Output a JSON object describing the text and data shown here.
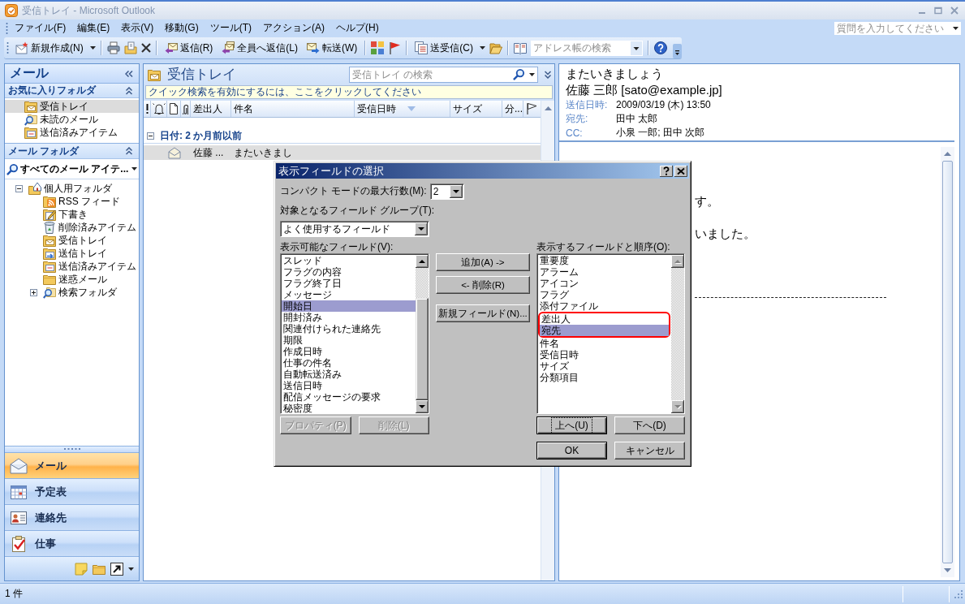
{
  "window": {
    "title": "受信トレイ - Microsoft Outlook"
  },
  "menu_bar": {
    "items": [
      "ファイル(F)",
      "編集(E)",
      "表示(V)",
      "移動(G)",
      "ツール(T)",
      "アクション(A)",
      "ヘルプ(H)"
    ],
    "help_search": {
      "placeholder": "質問を入力してください"
    }
  },
  "toolbar": {
    "new_button": "新規作成(N)",
    "respond_buttons": [
      "返信(R)",
      "全員へ返信(L)",
      "転送(W)"
    ],
    "send_receive_button": "送受信(C)",
    "address_search": {
      "placeholder": "アドレス帳の検索"
    }
  },
  "nav_pane": {
    "title": "メール",
    "favorites": {
      "title": "お気に入りフォルダ",
      "items": [
        {
          "label": "受信トレイ",
          "selected": true
        },
        {
          "label": "未読のメール",
          "selected": false
        },
        {
          "label": "送信済みアイテム",
          "selected": false
        }
      ]
    },
    "mail_folders": {
      "title": "メール フォルダ",
      "view": "すべてのメール アイテ...",
      "tree": [
        {
          "label": "個人用フォルダ",
          "expanded": true,
          "selected": false,
          "children": [
            {
              "label": "RSS フィード",
              "selected": false
            },
            {
              "label": "下書き",
              "selected": false
            },
            {
              "label": "削除済みアイテム",
              "selected": false
            },
            {
              "label": "受信トレイ",
              "selected": false
            },
            {
              "label": "送信トレイ",
              "selected": false
            },
            {
              "label": "送信済みアイテム",
              "selected": false
            },
            {
              "label": "迷惑メール",
              "selected": false
            },
            {
              "label": "検索フォルダ",
              "expanded": false,
              "selected": false
            }
          ]
        }
      ]
    },
    "buttons": [
      {
        "label": "メール",
        "selected": true
      },
      {
        "label": "予定表",
        "selected": false
      },
      {
        "label": "連絡先",
        "selected": false
      },
      {
        "label": "仕事",
        "selected": false
      }
    ]
  },
  "mail_list": {
    "title": "受信トレイ",
    "search": {
      "placeholder": "受信トレイ の検索"
    },
    "info_bar": "クイック検索を有効にするには、ここをクリックしてください",
    "columns": [
      {
        "label": "差出人",
        "sorted": false
      },
      {
        "label": "件名",
        "sorted": false
      },
      {
        "label": "受信日時",
        "sorted": true
      },
      {
        "label": "サイズ",
        "sorted": false
      },
      {
        "label": "分...",
        "sorted": false
      }
    ],
    "groups": [
      {
        "label": "日付: 2 か月前以前",
        "expanded": true,
        "rows": [
          {
            "sender": "佐藤 ...",
            "subject": "またいきまし",
            "selected": true,
            "read": true
          }
        ]
      }
    ]
  },
  "reading_pane": {
    "subject": "またいきましょう",
    "sender": "佐藤 三郎 [sato@example.jp]",
    "fields": [
      {
        "label": "送信日時:",
        "value": "2009/03/19 (木) 13:50"
      },
      {
        "label": "宛先:",
        "value": "田中 太郎"
      },
      {
        "label": "CC:",
        "value": "小泉 一郎; 田中 次郎"
      }
    ],
    "body_lines": [
      "す。",
      "いました。"
    ]
  },
  "dialog": {
    "title": "表示フィールドの選択",
    "max_rows": {
      "label": "コンパクト モードの最大行数(M):",
      "value": "2"
    },
    "field_group": {
      "label": "対象となるフィールド グループ(T):",
      "value": "よく使用するフィールド"
    },
    "available": {
      "label": "表示可能なフィールド(V):",
      "items": [
        {
          "label": "スレッド",
          "selected": false
        },
        {
          "label": "フラグの内容",
          "selected": false
        },
        {
          "label": "フラグ終了日",
          "selected": false
        },
        {
          "label": "メッセージ",
          "selected": false
        },
        {
          "label": "開始日",
          "selected": true
        },
        {
          "label": "開封済み",
          "selected": false
        },
        {
          "label": "関連付けられた連絡先",
          "selected": false
        },
        {
          "label": "期限",
          "selected": false
        },
        {
          "label": "作成日時",
          "selected": false
        },
        {
          "label": "仕事の件名",
          "selected": false
        },
        {
          "label": "自動転送済み",
          "selected": false
        },
        {
          "label": "送信日時",
          "selected": false
        },
        {
          "label": "配信メッセージの要求",
          "selected": false
        },
        {
          "label": "秘密度",
          "selected": false
        }
      ]
    },
    "move_buttons": [
      "追加(A) ->",
      "<- 削除(R)",
      "新規フィールド(N)..."
    ],
    "shown": {
      "label": "表示するフィールドと順序(O):",
      "items": [
        {
          "label": "重要度",
          "selected": false,
          "marked": false
        },
        {
          "label": "アラーム",
          "selected": false,
          "marked": false
        },
        {
          "label": "アイコン",
          "selected": false,
          "marked": false
        },
        {
          "label": "フラグ",
          "selected": false,
          "marked": false
        },
        {
          "label": "添付ファイル",
          "selected": false,
          "marked": false
        },
        {
          "label": "差出人",
          "selected": false,
          "marked": true
        },
        {
          "label": "宛先",
          "selected": true,
          "marked": true
        },
        {
          "label": "件名",
          "selected": false,
          "marked": false
        },
        {
          "label": "受信日時",
          "selected": false,
          "marked": false
        },
        {
          "label": "サイズ",
          "selected": false,
          "marked": false
        },
        {
          "label": "分類項目",
          "selected": false,
          "marked": false
        }
      ]
    },
    "field_buttons": [
      {
        "label": "プロパティ(P)",
        "disabled": true
      },
      {
        "label": "削除(L)",
        "disabled": true
      }
    ],
    "order_buttons": [
      {
        "label": "上へ(U)",
        "focused": true
      },
      {
        "label": "下へ(D)",
        "focused": false
      }
    ],
    "confirm_buttons": [
      {
        "label": "OK",
        "default": true
      },
      {
        "label": "キャンセル",
        "default": false
      }
    ]
  },
  "status_bar": {
    "text": "1 件"
  }
}
